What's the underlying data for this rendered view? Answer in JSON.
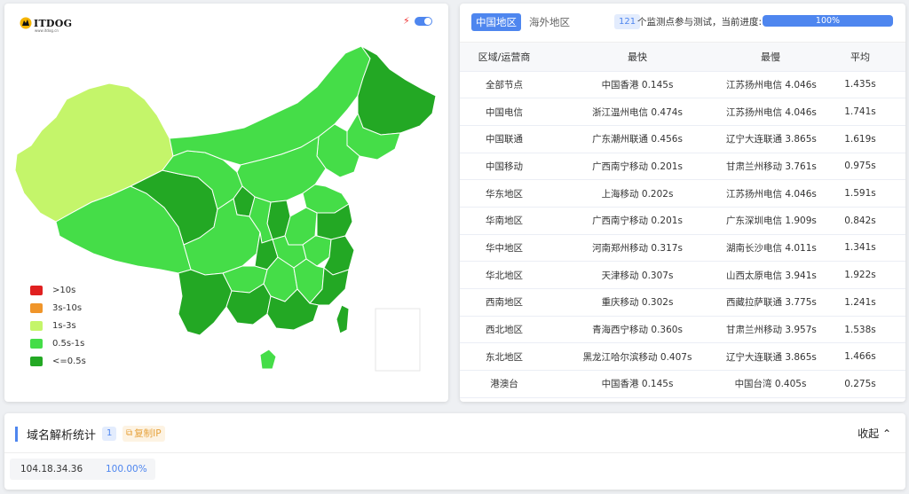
{
  "map_panel": {
    "logo_text": "ITDOG",
    "logo_subtext": "www.itdog.cn",
    "toggle_on": true,
    "legend": [
      {
        "label": ">10s",
        "color": "#e02020"
      },
      {
        "label": "3s-10s",
        "color": "#f0952a"
      },
      {
        "label": "1s-3s",
        "color": "#c4f56a"
      },
      {
        "label": "0.5s-1s",
        "color": "#45dd48"
      },
      {
        "label": "<=0.5s",
        "color": "#23a824"
      }
    ]
  },
  "table_panel": {
    "tabs": [
      {
        "label": "中国地区",
        "active": true
      },
      {
        "label": "海外地区",
        "active": false
      }
    ],
    "node_count": "121",
    "node_text": "个监测点参与测试，当前进度:",
    "progress_percent": 100,
    "progress_label": "100%",
    "columns": [
      "区域/运营商",
      "最快",
      "最慢",
      "平均"
    ],
    "rows": [
      [
        "全部节点",
        "中国香港 0.145s",
        "江苏扬州电信 4.046s",
        "1.435s"
      ],
      [
        "中国电信",
        "浙江温州电信 0.474s",
        "江苏扬州电信 4.046s",
        "1.741s"
      ],
      [
        "中国联通",
        "广东潮州联通 0.456s",
        "辽宁大连联通 3.865s",
        "1.619s"
      ],
      [
        "中国移动",
        "广西南宁移动 0.201s",
        "甘肃兰州移动 3.761s",
        "0.975s"
      ],
      [
        "华东地区",
        "上海移动 0.202s",
        "江苏扬州电信 4.046s",
        "1.591s"
      ],
      [
        "华南地区",
        "广西南宁移动 0.201s",
        "广东深圳电信 1.909s",
        "0.842s"
      ],
      [
        "华中地区",
        "河南郑州移动 0.317s",
        "湖南长沙电信 4.011s",
        "1.341s"
      ],
      [
        "华北地区",
        "天津移动 0.307s",
        "山西太原电信 3.941s",
        "1.922s"
      ],
      [
        "西南地区",
        "重庆移动 0.302s",
        "西藏拉萨联通 3.775s",
        "1.241s"
      ],
      [
        "西北地区",
        "青海西宁移动 0.360s",
        "甘肃兰州移动 3.957s",
        "1.538s"
      ],
      [
        "东北地区",
        "黑龙江哈尔滨移动 0.407s",
        "辽宁大连联通 3.865s",
        "1.466s"
      ],
      [
        "港澳台",
        "中国香港 0.145s",
        "中国台湾 0.405s",
        "0.275s"
      ]
    ]
  },
  "dns_panel": {
    "title": "域名解析统计",
    "count": "1",
    "copy_label": "复制IP",
    "collapse_label": "收起",
    "ips": [
      {
        "ip": "104.18.34.36",
        "percent": "100.00%"
      }
    ]
  },
  "colors": {
    "accent": "#4e86ef",
    "light_green": "#c4f56a",
    "mid_green": "#45dd48",
    "dark_green": "#23a824"
  },
  "icons": [
    "bolt-icon",
    "toggle-switch",
    "copy-icon",
    "chevron-up-icon"
  ]
}
